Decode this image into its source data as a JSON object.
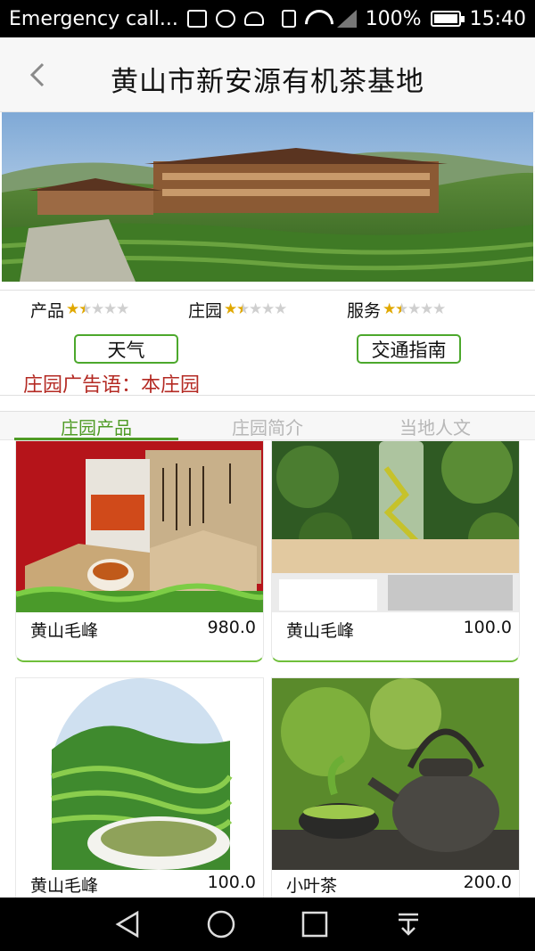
{
  "status_bar": {
    "carrier_text": "Emergency call...",
    "battery": "100%",
    "time": "15:40"
  },
  "header": {
    "title": "黄山市新安源有机茶基地",
    "back_icon": "chevron-left-icon"
  },
  "ratings": [
    {
      "label": "产品",
      "score": 1.5,
      "max": 5
    },
    {
      "label": "庄园",
      "score": 1.5,
      "max": 5
    },
    {
      "label": "服务",
      "score": 1.5,
      "max": 5
    }
  ],
  "buttons": {
    "weather": "天气",
    "traffic": "交通指南"
  },
  "ad_slogan": "庄园广告语：本庄园",
  "tabs": [
    {
      "label": "庄园产品",
      "active": true
    },
    {
      "label": "庄园简介",
      "active": false
    },
    {
      "label": "当地人文",
      "active": false
    }
  ],
  "products": [
    {
      "name": "黄山毛峰",
      "price": "980.0"
    },
    {
      "name": "黄山毛峰",
      "price": "100.0"
    },
    {
      "name": "黄山毛峰",
      "price": "100.0"
    },
    {
      "name": "小叶茶",
      "price": "200.0"
    }
  ],
  "nav": {
    "back": "triangle-back-icon",
    "home": "circle-home-icon",
    "recents": "square-recents-icon",
    "menu": "pull-down-icon"
  },
  "colors": {
    "accent_green": "#4f9b25",
    "ad_red": "#b42a23",
    "star_gold": "#e0a800"
  }
}
